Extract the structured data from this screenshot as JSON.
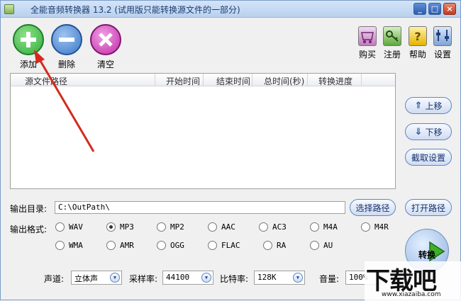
{
  "window": {
    "title": "全能音频转换器 13.2 (试用版只能转换源文件的一部分)",
    "minimize": "_",
    "maximize": "□",
    "close": "×"
  },
  "toolbar": {
    "add_label": "添加",
    "delete_label": "删除",
    "clear_label": "清空",
    "buy_label": "购买",
    "register_label": "注册",
    "help_label": "帮助",
    "settings_label": "设置"
  },
  "filelist": {
    "columns": [
      "源文件路径",
      "开始时间",
      "结束时间",
      "总时间(秒)",
      "转换进度"
    ]
  },
  "sidebuttons": {
    "move_up": "上移",
    "move_down": "下移",
    "cut_settings": "截取设置",
    "open_path": "打开路径"
  },
  "output": {
    "dir_label": "输出目录:",
    "dir_value": "C:\\OutPath\\",
    "choose_path": "选择路径",
    "format_label": "输出格式:",
    "formats": [
      "WAV",
      "MP3",
      "MP2",
      "AAC",
      "AC3",
      "M4A",
      "M4R",
      "WMA",
      "AMR",
      "OGG",
      "FLAC",
      "RA",
      "AU"
    ],
    "selected_format": "MP3"
  },
  "params": {
    "channel_label": "声道:",
    "channel_value": "立体声",
    "samplerate_label": "采样率:",
    "samplerate_value": "44100",
    "bitrate_label": "比特率:",
    "bitrate_value": "128K",
    "volume_label": "音量:",
    "volume_value": "100%"
  },
  "convert": {
    "label": "转换"
  },
  "watermark": {
    "big": "下载吧",
    "small": "www.xiazaiba.com"
  },
  "colors": {
    "add": "#2fae3a",
    "delete": "#3a78c8",
    "clear": "#c02aa8",
    "arrow": "#d42a1e"
  }
}
